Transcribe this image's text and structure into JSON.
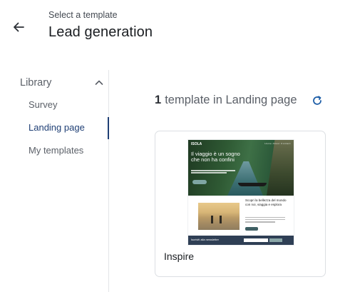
{
  "header": {
    "subtitle": "Select a template",
    "title": "Lead generation",
    "back_icon": "arrow-left-icon"
  },
  "sidebar": {
    "section_label": "Library",
    "section_icon": "chevron-up-icon",
    "items": [
      {
        "label": "Survey",
        "active": false
      },
      {
        "label": "Landing page",
        "active": true
      },
      {
        "label": "My templates",
        "active": false
      }
    ],
    "active_color": "#1f3f75"
  },
  "main": {
    "count": "1",
    "count_label": "template in Landing page",
    "refresh_icon": "refresh-icon",
    "accent_color": "#1f5fa8"
  },
  "templates": [
    {
      "name": "Inspire",
      "thumbnail": {
        "logo": "ISOLA",
        "nav": "Home  About  Contact",
        "headline": "Il viaggio è un sogno che non ha confini",
        "section_title": "Scopri la bellezza del mondo con noi, viaggia e esplora",
        "footer_text": "Iscriviti alla newsletter"
      }
    }
  ]
}
